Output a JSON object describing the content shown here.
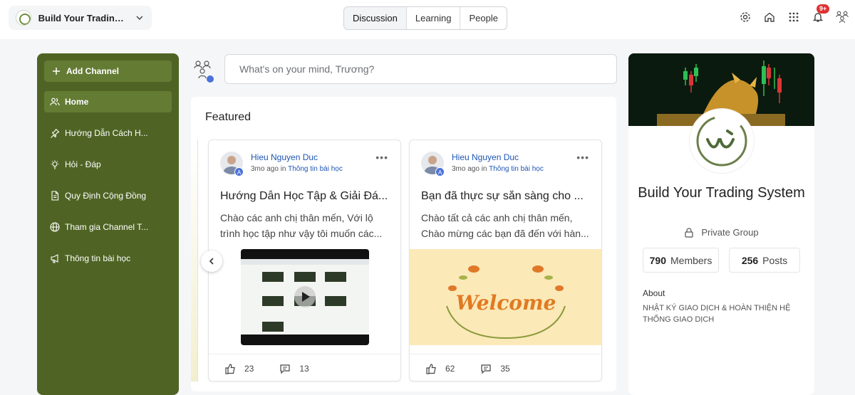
{
  "header": {
    "group_name": "Build Your Trading ...",
    "tabs": [
      "Discussion",
      "Learning",
      "People"
    ],
    "active_tab": "Discussion",
    "notification_badge": "9+"
  },
  "sidebar": {
    "add_channel": "Add Channel",
    "items": [
      {
        "label": "Home",
        "icon": "people-icon",
        "active": true
      },
      {
        "label": "Hướng Dẫn Cách H...",
        "icon": "pin-icon"
      },
      {
        "label": "Hỏi - Đáp",
        "icon": "lightbulb-icon"
      },
      {
        "label": "Quy Định Cộng Đồng",
        "icon": "document-icon"
      },
      {
        "label": "Tham gia Channel T...",
        "icon": "globe-icon"
      },
      {
        "label": "Thông tin bài học",
        "icon": "megaphone-icon"
      }
    ]
  },
  "composer": {
    "placeholder": "What's on your mind, Trương?"
  },
  "featured": {
    "title": "Featured",
    "cards": [
      {
        "author": "Hieu Nguyen Duc",
        "time": "3mo ago",
        "in": "in",
        "channel": "Thông tin bài học",
        "title": "Hướng Dẫn Học Tập & Giải Đá...",
        "body_line1": "Chào các anh chị thân mến, Với lộ",
        "body_line2": "trình học tập như vậy tôi muốn các...",
        "likes": "23",
        "comments": "13",
        "media": "video"
      },
      {
        "author": "Hieu Nguyen Duc",
        "time": "3mo ago",
        "in": "in",
        "channel": "Thông tin bài học",
        "title": "Bạn đã thực sự sẵn sàng cho ...",
        "body_line1": "Chào tất cả các anh chị thân mến,",
        "body_line2": "Chào mừng các bạn đã đến với hàn...",
        "likes": "62",
        "comments": "35",
        "media": "Welcome"
      }
    ]
  },
  "group": {
    "name": "Build Your Trading System",
    "privacy": "Private Group",
    "members_count": "790",
    "members_label": "Members",
    "posts_count": "256",
    "posts_label": "Posts",
    "about_title": "About",
    "about_text": "NHẬT KÝ GIAO DỊCH & HOÀN THIỆN HỆ THỐNG GIAO DỊCH"
  },
  "colors": {
    "sidebar": "#4f6424",
    "sidebar_active": "#647b34",
    "link": "#1e55b3",
    "badge": "#e03131"
  }
}
